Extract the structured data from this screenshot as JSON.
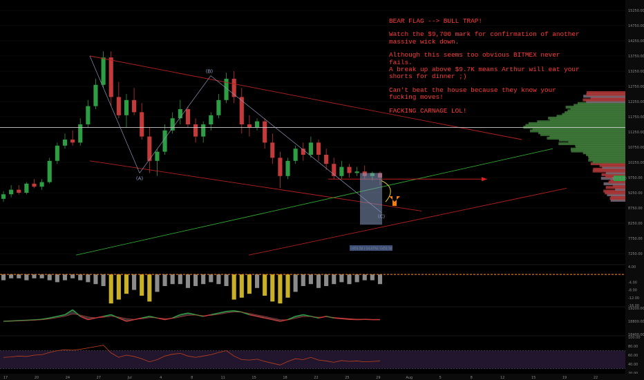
{
  "annotation": {
    "lines": [
      "BEAR FLAG --> BULL TRAP!",
      "Watch the $9,700 mark for confirmation of another massive wick down.",
      "Although this seems too obvious BITMEX never fails.\nA break up above $9.7K means Arthur will eat your shorts for dinner ;)",
      "Can't beat the house because they know your fucking moves!",
      "FACKING CARNAGE LOL!"
    ]
  },
  "chart_data": {
    "type": "candlestick",
    "price_axis": {
      "ticks": [
        "15250.00",
        "14750.00",
        "14250.00",
        "13750.00",
        "13250.00",
        "12750.00",
        "12250.00",
        "11750.00",
        "11250.00",
        "10750.00",
        "10250.00",
        "9750.00",
        "9250.00",
        "8750.00",
        "8250.00",
        "7750.00",
        "7250.00"
      ],
      "ylim": [
        7000,
        15500
      ]
    },
    "date_axis": {
      "ticks": [
        "17",
        "20",
        "24",
        "27",
        "Jul",
        "4",
        "8",
        "11",
        "15",
        "18",
        "22",
        "25",
        "29",
        "Aug",
        "5",
        "8",
        "12",
        "15",
        "19",
        "22"
      ]
    },
    "current_price_label": "9725.00",
    "horizontal_level": 11400,
    "target_level": 9700,
    "box_label": "-1451.50 (-14.47%) -1451.50",
    "wave_labels": [
      "(A)",
      "(B)",
      "(C)"
    ],
    "candles_ohlc": [
      [
        9050,
        9300,
        8950,
        9200
      ],
      [
        9200,
        9500,
        9100,
        9350
      ],
      [
        9350,
        9500,
        9200,
        9250
      ],
      [
        9250,
        9600,
        9200,
        9550
      ],
      [
        9550,
        9700,
        9400,
        9450
      ],
      [
        9450,
        9700,
        9350,
        9600
      ],
      [
        9600,
        10400,
        9550,
        10300
      ],
      [
        10300,
        10900,
        10200,
        10800
      ],
      [
        10800,
        11200,
        10700,
        11000
      ],
      [
        11000,
        11300,
        10800,
        10900
      ],
      [
        10900,
        11700,
        10800,
        11500
      ],
      [
        11500,
        12300,
        11400,
        12100
      ],
      [
        12100,
        13000,
        12000,
        12800
      ],
      [
        12800,
        13900,
        12700,
        13700
      ],
      [
        13700,
        13900,
        12100,
        12400
      ],
      [
        12400,
        12900,
        11700,
        11800
      ],
      [
        11800,
        12500,
        11400,
        12300
      ],
      [
        12300,
        12700,
        11800,
        11900
      ],
      [
        11900,
        12200,
        11000,
        11100
      ],
      [
        11100,
        11400,
        9900,
        10300
      ],
      [
        10300,
        10700,
        9800,
        10600
      ],
      [
        10600,
        11500,
        10500,
        11300
      ],
      [
        11300,
        11900,
        11200,
        11700
      ],
      [
        11700,
        12300,
        11500,
        12000
      ],
      [
        12000,
        12100,
        11400,
        11500
      ],
      [
        11500,
        11700,
        10900,
        11100
      ],
      [
        11100,
        11600,
        10900,
        11500
      ],
      [
        11500,
        11900,
        11300,
        11800
      ],
      [
        11800,
        12500,
        11700,
        12300
      ],
      [
        12300,
        13200,
        12200,
        13000
      ],
      [
        13000,
        13250,
        12200,
        12400
      ],
      [
        12400,
        12700,
        11200,
        11500
      ],
      [
        11500,
        11800,
        11100,
        11400
      ],
      [
        11400,
        11700,
        11300,
        11600
      ],
      [
        11600,
        11700,
        10700,
        10900
      ],
      [
        10900,
        11200,
        10200,
        10400
      ],
      [
        10400,
        10600,
        9400,
        9800
      ],
      [
        9800,
        10400,
        9700,
        10300
      ],
      [
        10300,
        10800,
        10200,
        10700
      ],
      [
        10700,
        10900,
        10300,
        10500
      ],
      [
        10500,
        11100,
        10400,
        10900
      ],
      [
        10900,
        11000,
        10300,
        10500
      ],
      [
        10500,
        10700,
        10000,
        10200
      ],
      [
        10200,
        10400,
        9700,
        9800
      ],
      [
        9800,
        10300,
        9700,
        10100
      ],
      [
        10100,
        10200,
        9750,
        9900
      ],
      [
        9900,
        10100,
        9800,
        9950
      ],
      [
        9950,
        10150,
        9700,
        9800
      ],
      [
        9800,
        9950,
        9650,
        9900
      ],
      [
        9900,
        9950,
        9500,
        9750
      ]
    ],
    "volume_panel": {
      "ylim": [
        -16,
        4
      ],
      "ticks": [
        "4.00",
        "-4.00",
        "-8.00",
        "-12.00",
        "-16.00"
      ],
      "values": [
        -3,
        -2,
        -2,
        -3,
        -2,
        -2,
        -3,
        -4,
        -3,
        -2,
        -3,
        -4,
        -5,
        -6,
        -15,
        -13,
        -10,
        -8,
        -11,
        -14,
        -9,
        -6,
        -5,
        -5,
        -7,
        -6,
        -5,
        -4,
        -5,
        -6,
        -13,
        -12,
        -10,
        -7,
        -11,
        -14,
        -15,
        -12,
        -9,
        -6,
        -5,
        -7,
        -6,
        -5,
        -4,
        -5,
        -4,
        -3,
        -3,
        -5
      ]
    },
    "oscillator_panel": {
      "ylim": [
        18400,
        19200
      ],
      "ticks": [
        "19200.00",
        "18800.00",
        "18400.00"
      ],
      "fast": [
        18800,
        18810,
        18820,
        18830,
        18840,
        18860,
        18900,
        18950,
        19000,
        19150,
        18950,
        18850,
        18900,
        18950,
        19000,
        18900,
        18800,
        18850,
        18900,
        18950,
        18900,
        18850,
        18900,
        19000,
        19050,
        19000,
        18950,
        19000,
        19050,
        19100,
        19120,
        19080,
        19000,
        18950,
        18900,
        18850,
        18800,
        18850,
        18950,
        19000,
        18950,
        18900,
        18950,
        18900,
        18880,
        18860,
        18850,
        18860,
        18850,
        18850
      ],
      "slow": [
        18800,
        18805,
        18812,
        18822,
        18832,
        18846,
        18872,
        18908,
        18950,
        19020,
        18990,
        18930,
        18910,
        18920,
        18950,
        18930,
        18880,
        18860,
        18875,
        18910,
        18905,
        18880,
        18885,
        18930,
        18980,
        18990,
        18970,
        18980,
        19010,
        19050,
        19080,
        19080,
        19040,
        18995,
        18950,
        18900,
        18850,
        18840,
        18890,
        18940,
        18945,
        18925,
        18935,
        18918,
        18900,
        18880,
        18865,
        18862,
        18856,
        18853
      ]
    },
    "rsi_panel": {
      "ylim": [
        20,
        100
      ],
      "ticks": [
        "100.00",
        "80.00",
        "60.00",
        "40.00",
        "20.00"
      ],
      "bands": [
        70,
        30
      ],
      "values": [
        55,
        56,
        58,
        57,
        60,
        61,
        66,
        70,
        72,
        71,
        73,
        76,
        79,
        82,
        65,
        55,
        60,
        57,
        52,
        45,
        50,
        58,
        62,
        64,
        58,
        55,
        58,
        61,
        66,
        70,
        58,
        50,
        49,
        51,
        46,
        42,
        38,
        46,
        52,
        50,
        55,
        49,
        47,
        44,
        48,
        46,
        47,
        45,
        46,
        47
      ]
    }
  }
}
